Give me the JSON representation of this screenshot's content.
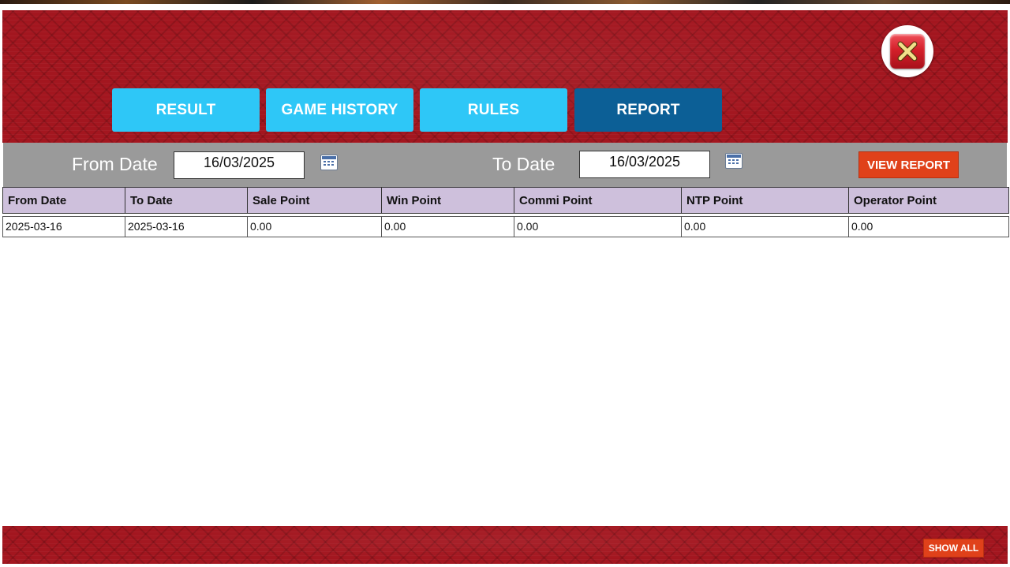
{
  "tabs": [
    {
      "label": "RESULT"
    },
    {
      "label": "GAME HISTORY"
    },
    {
      "label": "RULES"
    },
    {
      "label": "REPORT",
      "active": true
    }
  ],
  "filter": {
    "from_label": "From Date",
    "from_value": "16/03/2025",
    "to_label": "To Date",
    "to_value": "16/03/2025",
    "view_report_label": "VIEW REPORT"
  },
  "table": {
    "headers": [
      "From Date",
      "To Date",
      "Sale Point",
      "Win Point",
      "Commi Point",
      "NTP Point",
      "Operator Point"
    ],
    "rows": [
      [
        "2025-03-16",
        "2025-03-16",
        "0.00",
        "0.00",
        "0.00",
        "0.00",
        "0.00"
      ]
    ]
  },
  "footer": {
    "show_all_label": "SHOW ALL"
  },
  "colors": {
    "tab_inactive": "#2ec7f7",
    "tab_active": "#0c5f96",
    "action_button": "#e0411a",
    "header_background": "#a3161f",
    "table_header": "#cec0dc",
    "filter_bar": "#9a9a9a"
  },
  "icons": {
    "close": "close-icon",
    "calendar": "calendar-icon"
  }
}
